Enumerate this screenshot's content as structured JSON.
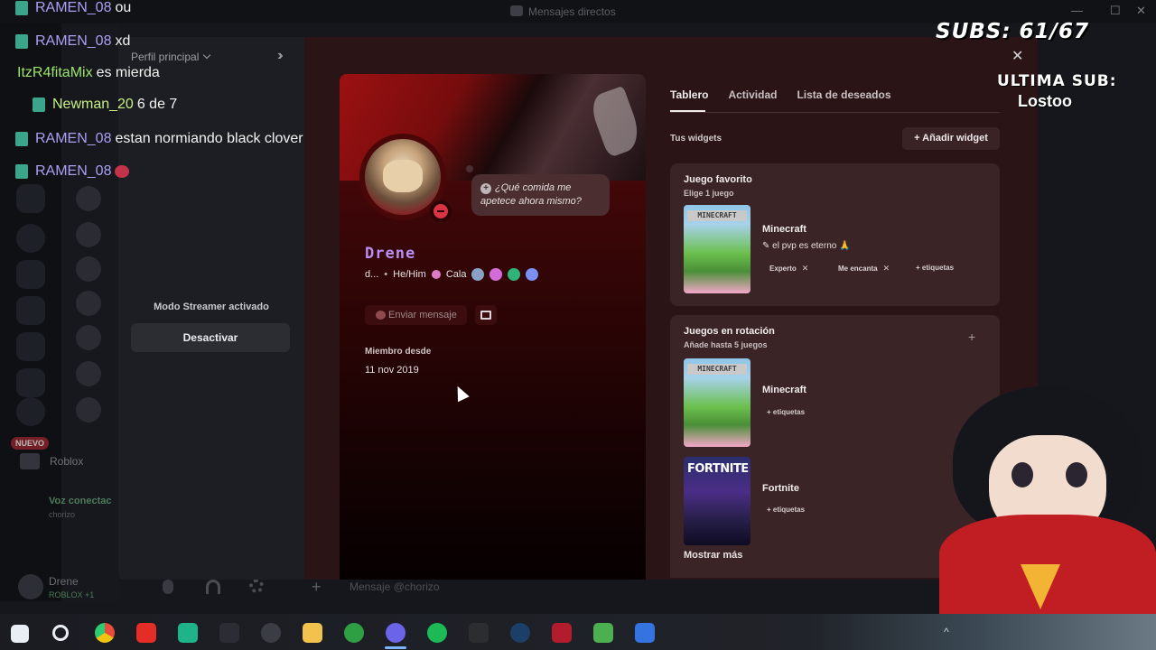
{
  "window": {
    "title": "Mensajes directos",
    "controls": [
      "—",
      "☐",
      "✕"
    ]
  },
  "background": {
    "nuevo_badge": "NUEVO",
    "roblox_label": "Roblox",
    "voice_connected": "Voz conectac",
    "voice_channel": "chorizo",
    "user_name": "Drene",
    "user_status": "ROBLOX +1",
    "message_placeholder": "Mensaje @chorizo"
  },
  "sidebar": {
    "profile_selector": "Perfil principal",
    "streamer_mode_label": "Modo Streamer activado",
    "deactivate_label": "Desactivar"
  },
  "profile": {
    "status_bubble": "¿Qué comida me apetece ahora mismo?",
    "display_name": "Drene",
    "username": "d...",
    "pronouns": "He/Him",
    "tag": "Cala",
    "send_message_label": "Enviar mensaje",
    "member_since_label": "Miembro desde",
    "member_since_date": "11 nov 2019",
    "badges": [
      {
        "name": "badge-1-icon",
        "color": "#8aa0c7"
      },
      {
        "name": "badge-2-icon",
        "color": "#d46bd9"
      },
      {
        "name": "badge-3-icon",
        "color": "#2fb37a"
      },
      {
        "name": "badge-4-icon",
        "color": "#7b8ff5"
      }
    ]
  },
  "tabs": {
    "items": [
      "Tablero",
      "Actividad",
      "Lista de deseados"
    ],
    "active": "Tablero"
  },
  "widgets": {
    "section_label": "Tus widgets",
    "add_label": "+ Añadir widget",
    "favorite": {
      "title": "Juego favorito",
      "subtitle": "Elige 1 juego",
      "game": "Minecraft",
      "note": "✎ el pvp es eterno 🙏",
      "tags": [
        "Experto",
        "Me encanta"
      ],
      "more_tags": "+ etiquetas"
    },
    "rotation": {
      "title": "Juegos en rotación",
      "subtitle": "Añade hasta 5 juegos",
      "add": "+",
      "games": [
        {
          "name": "Minecraft",
          "tags": "+ etiquetas",
          "art_logo": "MINECRAFT"
        },
        {
          "name": "Fortnite",
          "tags": "+ etiquetas",
          "art_logo": "FORTNITE"
        }
      ],
      "show_more": "Mostrar más"
    }
  },
  "chat_overlay": [
    {
      "user": "RAMEN_08",
      "text": "ou"
    },
    {
      "user": "RAMEN_08",
      "text": "xd"
    },
    {
      "user": "ItzR4fitaMix",
      "text": "es mierda"
    },
    {
      "user": "Newman_20",
      "text": "6 de 7"
    },
    {
      "user": "RAMEN_08",
      "text": "estan normiando black clover"
    },
    {
      "user": "RAMEN_08",
      "text": ""
    }
  ],
  "stream_overlay": {
    "subs": "SUBS: 61/67",
    "last_sub_label": "ULTIMA SUB:",
    "last_sub_name": "Lostoo"
  },
  "colors": {
    "accent_name": "#b88ef5",
    "modal_bg": "#2a1416",
    "dnd_status": "#d93444",
    "taskbar_active": "#7fb4ff"
  },
  "taskbar": {
    "icons": [
      "windows-start-icon",
      "search-icon",
      "chrome-icon",
      "youtube-icon",
      "app-icon",
      "valorant-icon",
      "obs-icon",
      "folder-icon",
      "xbox-icon",
      "discord-icon",
      "spotify-icon",
      "epic-games-icon",
      "steam-icon",
      "x-app-icon",
      "minecraft-icon",
      "roblox-icon"
    ],
    "active": "discord-icon"
  }
}
